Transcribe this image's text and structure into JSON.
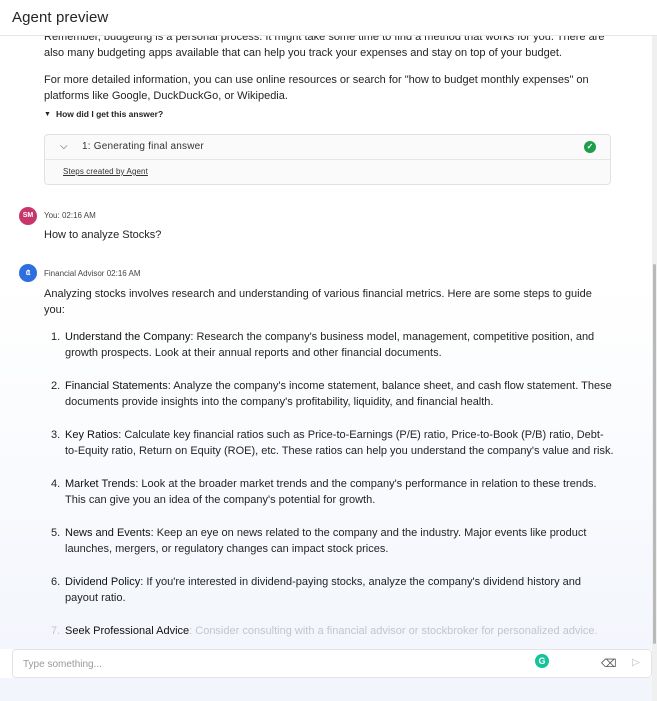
{
  "header": {
    "title": "Agent preview"
  },
  "previous_answer": {
    "cut_line": "Remember, budgeting is a personal process. It might take some time to find a method that works for you. There are also many budgeting apps available that can help you track your expenses and stay on top of your budget.",
    "more_info": "For more detailed information, you can use online resources or search for \"how to budget monthly expenses\" on platforms like Google, DuckDuckGo, or Wikipedia.",
    "how_label": "How did I get this answer?",
    "step_label": "1:  Generating final answer",
    "steps_footer": "Steps created by Agent"
  },
  "user_message": {
    "avatar_initials": "SM",
    "meta": "You: 02:16 AM",
    "text": "How to analyze Stocks?"
  },
  "bot_message": {
    "meta": "Financial Advisor 02:16 AM",
    "intro": "Analyzing stocks involves research and understanding of various financial metrics. Here are some steps to guide you:",
    "items": [
      {
        "num": "1.",
        "title": "Understand the Company",
        "text": ": Research the company's business model, management, competitive position, and growth prospects. Look at their annual reports and other financial documents."
      },
      {
        "num": "2.",
        "title": "Financial Statements",
        "text": ": Analyze the company's income statement, balance sheet, and cash flow statement. These documents provide insights into the company's profitability, liquidity, and financial health."
      },
      {
        "num": "3.",
        "title": "Key Ratios",
        "text": ": Calculate key financial ratios such as Price-to-Earnings (P/E) ratio, Price-to-Book (P/B) ratio, Debt-to-Equity ratio, Return on Equity (ROE), etc. These ratios can help you understand the company's value and risk."
      },
      {
        "num": "4.",
        "title": "Market Trends",
        "text": ": Look at the broader market trends and the company's performance in relation to these trends. This can give you an idea of the company's potential for growth."
      },
      {
        "num": "5.",
        "title": "News and Events",
        "text": ": Keep an eye on news related to the company and the industry. Major events like product launches, mergers, or regulatory changes can impact stock prices."
      },
      {
        "num": "6.",
        "title": "Dividend Policy",
        "text": ": If you're interested in dividend-paying stocks, analyze the company's dividend history and payout ratio."
      },
      {
        "num": "7.",
        "title": "Seek Professional Advice",
        "text": ": Consider consulting with a financial advisor or stockbroker for personalized advice."
      }
    ]
  },
  "input": {
    "placeholder": "Type something...",
    "value": ""
  },
  "icons": {
    "chevron": "chevron-down-icon",
    "check": "check-circle-icon",
    "grammarly": "grammarly-icon",
    "eraser": "eraser-icon",
    "send": "send-icon"
  },
  "colors": {
    "user_avatar": "#c7356b",
    "bot_avatar": "#2d6fe0",
    "success": "#1e9e4a",
    "grammarly": "#15c39a"
  }
}
